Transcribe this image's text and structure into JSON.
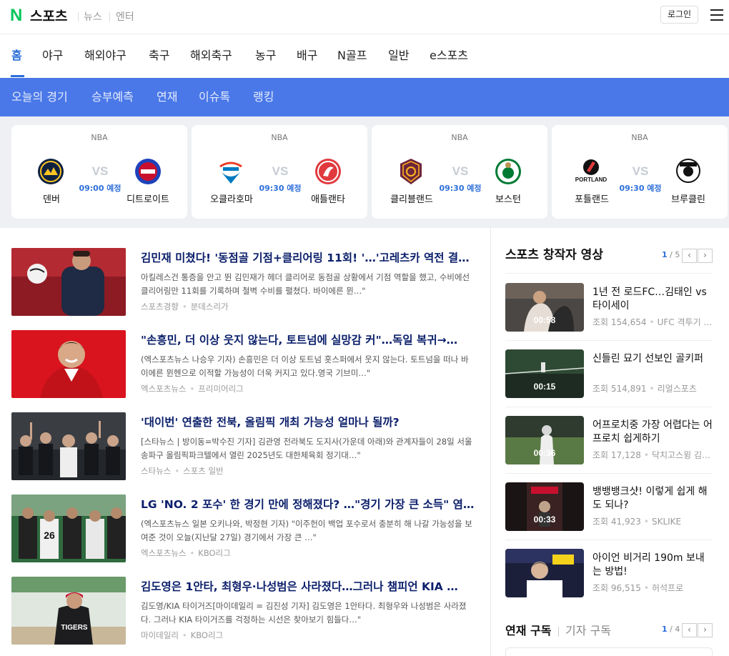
{
  "header": {
    "logo_letter": "N",
    "title": "스포츠",
    "links": [
      "뉴스",
      "엔터"
    ],
    "login_label": "로그인"
  },
  "main_tabs": [
    "홈",
    "야구",
    "해외야구",
    "축구",
    "해외축구",
    "농구",
    "배구",
    "N골프",
    "일반",
    "e스포츠"
  ],
  "sub_tabs": [
    "오늘의 경기",
    "승부예측",
    "연재",
    "이슈톡",
    "랭킹"
  ],
  "games": [
    {
      "league": "NBA",
      "vs": "VS",
      "time": "09:00 예정",
      "home": "덴버",
      "away": "디트로이트"
    },
    {
      "league": "NBA",
      "vs": "VS",
      "time": "09:30 예정",
      "home": "오클라호마",
      "away": "애틀랜타"
    },
    {
      "league": "NBA",
      "vs": "VS",
      "time": "09:30 예정",
      "home": "클리블랜드",
      "away": "보스턴"
    },
    {
      "league": "NBA",
      "vs": "VS",
      "time": "09:30 예정",
      "home": "포틀랜드",
      "away": "브루클린"
    }
  ],
  "news": [
    {
      "title": "김민재 미쳤다! '동점골 기점+클리어링 11회! '…'고레츠카 역전 결…",
      "desc": "아킬레스건 통증을 안고 뛴 김민재가 헤더 클리어로 동점골 상황에서 기점 역할을 했고, 수비에선 클리어링만 11회를 기록하며 철벽 수비를 펼쳤다. 바이에른 뮌…\"",
      "source": "스포츠경향",
      "category": "분데스리가"
    },
    {
      "title": "\"손흥민, 더 이상 웃지 않는다, 토트넘에 실망감 커\"…독일 복귀→…",
      "desc": "(엑스포츠뉴스 나승우 기자) 손흥민은 더 이상 토트넘 홋스퍼에서 웃지 않는다. 토트넘을 떠나 바이에른 뮌헨으로 이적할 가능성이 더욱 커지고 있다.영국 기브미…\"",
      "source": "엑스포츠뉴스",
      "category": "프리미어리그"
    },
    {
      "title": "'대이번' 연출한 전북, 올림픽 개최 가능성 얼마나 될까?",
      "desc": "[스타뉴스 | 방이동=박수진 기자] 김관영 전라북도 도지사(가운데 아래)와 관계자들이 28일 서울 송파구 올림픽파크텔에서 열린 2025년도 대한체육회 정기대…\"",
      "source": "스타뉴스",
      "category": "스포츠 일반"
    },
    {
      "title": "LG 'NO. 2 포수' 한 경기 만에 정해졌다? …\"경기 가장 큰 소득\" 염…",
      "desc": "(엑스포츠뉴스 일본 오키나와, 박정현 기자) \"이주헌이 백업 포수로서 충분히 해 나갈 가능성을 보여준 것이 오늘(지난달 27일) 경기에서 가장 큰 …\"",
      "source": "엑스포츠뉴스",
      "category": "KBO리그"
    },
    {
      "title": "김도영은 1안타, 최형우·나성범은 사라졌다…그러나 챔피언 KIA …",
      "desc": "김도영/KIA 타이거즈[마이데일리 = 김진성 기자] 김도영은 1안타다. 최형우와 나성범은 사라졌다. 그러나 KIA 타이거즈를 걱정하는 시선은 찾아보기 힘들다…\"",
      "source": "마이데일리",
      "category": "KBO리그"
    }
  ],
  "creators": {
    "title": "스포츠 창작자 영상",
    "page_current": "1",
    "page_total": "/ 5",
    "videos": [
      {
        "title": "1년 전 로드FC…김태인 vs 타이세이",
        "views": "조회 154,654",
        "channel": "UFC 격투기 …",
        "duration": "00:58"
      },
      {
        "title": "신들린 묘기 선보인 골키퍼",
        "views": "조회 514,891",
        "channel": "리얼스포츠",
        "duration": "00:15"
      },
      {
        "title": "어프로치중 가장 어렵다는 어프로치 쉽게하기",
        "views": "조회 17,128",
        "channel": "닥치고스윙 김…",
        "duration": "00:36"
      },
      {
        "title": "뱅뱅뱅크샷! 이렇게 쉽게 해도 되나?",
        "views": "조회 41,923",
        "channel": "SKLIKE",
        "duration": "00:33"
      },
      {
        "title": "아이언 비거리 190m 보내는 방법!",
        "views": "조회 96,515",
        "channel": "허석프로",
        "duration": "00:55"
      }
    ]
  },
  "subscribe": {
    "tab_series": "연재 구독",
    "tab_reporter": "기자 구독",
    "page_current": "1",
    "page_total": "/ 4"
  },
  "colors": {
    "accent": "#2e6fd9",
    "subnav_bg": "#4a78e8",
    "logo_green": "#03c75a",
    "title_navy": "#0b1f6b"
  },
  "icons": [
    "menu-icon",
    "chevron-left-icon",
    "chevron-right-icon",
    "team-logo-denver",
    "team-logo-detroit",
    "team-logo-okc",
    "team-logo-atlanta",
    "team-logo-cleveland",
    "team-logo-boston",
    "team-logo-portland",
    "team-logo-brooklyn"
  ]
}
